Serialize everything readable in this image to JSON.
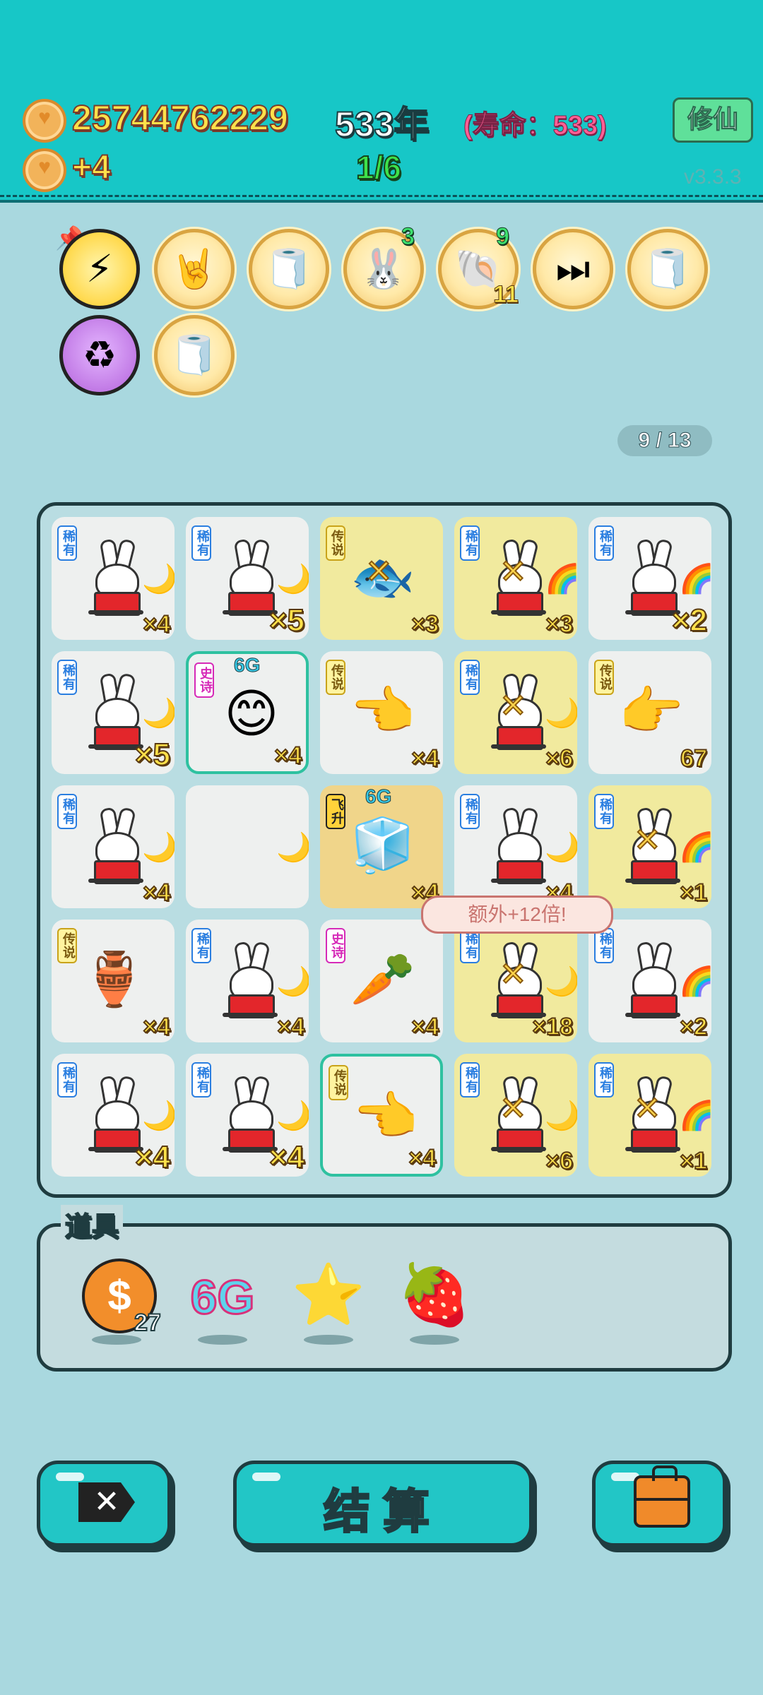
{
  "header": {
    "coins": "25744762229",
    "coin_gain": "+4",
    "year": "533年",
    "lifespan": "(寿命：533)",
    "turn": "1/6",
    "cultivate_button": "修仙",
    "version": "v3.3.3"
  },
  "relics": [
    {
      "name": "lightning-icon",
      "glyph": "⚡"
    },
    {
      "name": "rock-hand-icon",
      "glyph": "🤘"
    },
    {
      "name": "tissue-box-icon",
      "glyph": "🧻"
    },
    {
      "name": "bunny-heart-icon",
      "glyph": "🐰",
      "badge": "3"
    },
    {
      "name": "seashell-icon",
      "glyph": "🐚",
      "badge": "9",
      "badge2": "11"
    },
    {
      "name": "skip-icon",
      "glyph": "⏭"
    },
    {
      "name": "tissue-box-icon",
      "glyph": "🧻"
    },
    {
      "name": "recycle-icon",
      "glyph": "♻"
    },
    {
      "name": "tissue-box-icon",
      "glyph": "🧻"
    }
  ],
  "progress": "9 / 13",
  "tags": {
    "rare": "稀有",
    "legend": "传说",
    "epic": "史诗",
    "ascend": "飞升"
  },
  "grid": [
    [
      {
        "kind": "bunny",
        "tag": "稀有",
        "side": "🌙",
        "mult": "×4"
      },
      {
        "kind": "bunny",
        "tag": "稀有",
        "side": "🌙",
        "mult": "×5"
      },
      {
        "kind": "fish",
        "tag": "传说",
        "glyph": "🐟",
        "mult": "×3"
      },
      {
        "kind": "bunny",
        "tag": "稀有",
        "side": "🌈",
        "mult": "×3"
      },
      {
        "kind": "bunny",
        "tag": "稀有",
        "side": "🌈",
        "mult": "×2"
      }
    ],
    [
      {
        "kind": "bunny",
        "tag": "稀有",
        "side": "🌙",
        "mult": "×5"
      },
      {
        "kind": "face",
        "tag": "史诗",
        "glyph": "😊",
        "g": "6G",
        "mult": "×4"
      },
      {
        "kind": "hand",
        "tag": "传说",
        "glyph": "👈",
        "mult": "×4"
      },
      {
        "kind": "bunny",
        "tag": "稀有",
        "side": "🌙",
        "mult": "×6"
      },
      {
        "kind": "hand",
        "tag": "传说",
        "glyph": "👉",
        "mult": "67"
      }
    ],
    [
      {
        "kind": "bunny",
        "tag": "稀有",
        "side": "🌙",
        "mult": "×4"
      },
      {
        "kind": "empty",
        "side": "🌙"
      },
      {
        "kind": "fridge",
        "tag": "飞升",
        "glyph": "🧊",
        "g": "6G",
        "mult": "×4"
      },
      {
        "kind": "bunny",
        "tag": "稀有",
        "side": "🌙",
        "mult": "×4"
      },
      {
        "kind": "bunny",
        "tag": "稀有",
        "side": "🌈",
        "mult": "×1"
      }
    ],
    [
      {
        "kind": "vase",
        "tag": "传说",
        "glyph": "🏺",
        "mult": "×4"
      },
      {
        "kind": "bunny",
        "tag": "稀有",
        "side": "🌙",
        "mult": "×4"
      },
      {
        "kind": "carrot",
        "tag": "史诗",
        "glyph": "🥕",
        "mult": "×4"
      },
      {
        "kind": "bunny",
        "tag": "稀有",
        "side": "🌙",
        "mult": "×18"
      },
      {
        "kind": "bunny",
        "tag": "稀有",
        "side": "🌈",
        "mult": "×2"
      }
    ],
    [
      {
        "kind": "bunny",
        "tag": "稀有",
        "side": "🌙",
        "mult": "×4"
      },
      {
        "kind": "bunny",
        "tag": "稀有",
        "side": "🌙",
        "mult": "×4"
      },
      {
        "kind": "hand",
        "tag": "传说",
        "glyph": "👈",
        "mult": "×4"
      },
      {
        "kind": "bunny",
        "tag": "稀有",
        "side": "🌙",
        "mult": "×6"
      },
      {
        "kind": "bunny",
        "tag": "稀有",
        "side": "🌈",
        "mult": "×1"
      }
    ]
  ],
  "bubble": "额外+12倍!",
  "items": {
    "title": "道具",
    "list": [
      {
        "name": "dollar-coin-icon",
        "glyph": "$",
        "count": "27"
      },
      {
        "name": "6g-icon",
        "glyph": "6G"
      },
      {
        "name": "star-icon",
        "glyph": "⭐"
      },
      {
        "name": "strawberry-icon",
        "glyph": "🍓"
      }
    ]
  },
  "buttons": {
    "exit": "✕",
    "settle": "结算",
    "bag": "bag"
  },
  "colors": {
    "header_bg": "#17c7c7",
    "page_bg": "#a9d8df",
    "gold_text": "#ffe14a",
    "life_text": "#ff5f95",
    "turn_text": "#3ee24a"
  }
}
